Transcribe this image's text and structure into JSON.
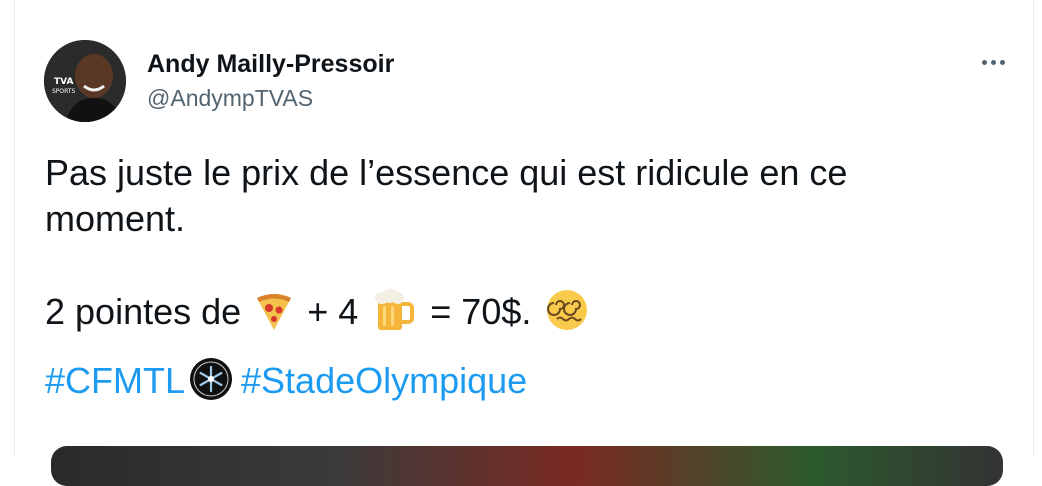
{
  "tweet": {
    "author_name": "Andy Mailly-Pressoir",
    "author_handle": "@AndympTVAS",
    "avatar_badge": "TVA SPORTS",
    "more_icon": "more-horizontal-icon",
    "text_line1": "Pas juste le prix de l’essence qui est ridicule en ce",
    "text_line2": "moment.",
    "text_line3_a": "2 pointes de",
    "text_line3_b": "+ 4",
    "text_line3_c": "= 70$.",
    "emojis": [
      "pizza-emoji",
      "beer-mug-emoji",
      "dizzy-face-emoji"
    ],
    "hashtag1": "#CFMTL",
    "hashtag2": "#StadeOlympique",
    "colors": {
      "link": "#1d9bf0",
      "text": "#0f1419",
      "secondary": "#536471"
    }
  }
}
